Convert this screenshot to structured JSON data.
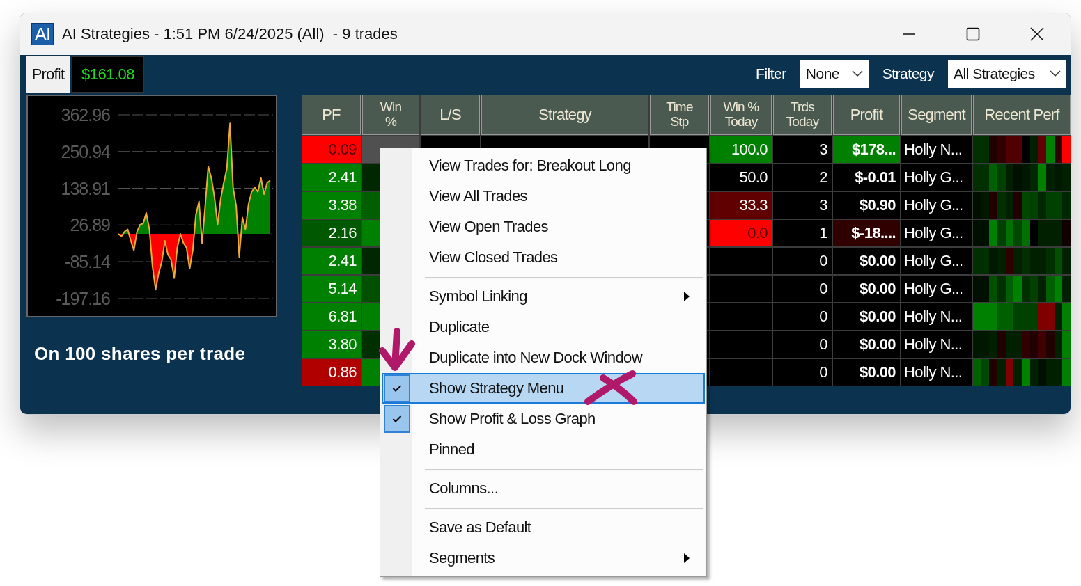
{
  "window": {
    "logo": "AI",
    "title": "AI Strategies - 1:51 PM 6/24/2025 (All)  - 9 trades"
  },
  "summary": {
    "label": "Profit",
    "value": "$161.08",
    "caption": "On 100 shares per trade"
  },
  "chart_data": {
    "type": "line",
    "grid": true,
    "ylim": [
      -197.16,
      362.96
    ],
    "yticks": [
      {
        "value": 362.96,
        "label": "362.96"
      },
      {
        "value": 250.94,
        "label": "250.94"
      },
      {
        "value": 138.91,
        "label": "138.91"
      },
      {
        "value": 26.89,
        "label": "26.89"
      },
      {
        "value": -85.14,
        "label": "-85.14"
      },
      {
        "value": -197.16,
        "label": "-197.16"
      }
    ],
    "series": [
      {
        "color": "#f0a838",
        "values": [
          0,
          -7,
          7,
          14,
          -21,
          -50,
          7,
          28,
          32,
          64,
          14,
          -99,
          -170,
          -120,
          -85,
          -21,
          -64,
          -78,
          -135,
          -43,
          0,
          -28,
          -43,
          -106,
          -50,
          57,
          99,
          -28,
          85,
          206,
          170,
          113,
          28,
          106,
          156,
          199,
          337,
          142,
          85,
          -71,
          50,
          14,
          92,
          128,
          142,
          128,
          170,
          121,
          156,
          163
        ]
      }
    ]
  },
  "filter": {
    "label": "Filter",
    "value": "None"
  },
  "strategy_filter": {
    "label": "Strategy",
    "value": "All Strategies"
  },
  "table": {
    "columns": [
      "PF",
      "Win\n%",
      "L/S",
      "Strategy",
      "Time\nStp",
      "Win %\nToday",
      "Trds\nToday",
      "Profit",
      "Segment",
      "Recent Perf"
    ],
    "rows": [
      {
        "pf": {
          "text": "0.09",
          "color": "#ff0000"
        },
        "win": {
          "color": "#505050"
        },
        "today_win": {
          "text": "100.0",
          "color": "#008000"
        },
        "trades": "3",
        "profit": {
          "text": "$178...",
          "color": "#008000"
        },
        "segment": "Holly N...",
        "perf": [
          {
            "color": "#003000"
          },
          {
            "color": "#003000"
          },
          {
            "color": "#200000"
          },
          {
            "color": "#300000"
          },
          {
            "color": "#500000"
          },
          {
            "color": "#500000"
          },
          {
            "color": "#000000"
          },
          {
            "color": "#002000"
          },
          {
            "color": "#600000"
          },
          {
            "color": "#008000"
          },
          {
            "color": "#300000"
          },
          {
            "color": "#ff0000"
          }
        ]
      },
      {
        "pf": {
          "text": "2.41",
          "color": "#008000"
        },
        "win": {
          "color": "#002800"
        },
        "today_win": {
          "text": "50.0",
          "color": "#000000"
        },
        "trades": "2",
        "profit": {
          "text": "$-0.01",
          "color": "#000000"
        },
        "segment": "Holly G...",
        "perf": [
          {
            "color": "#003000"
          },
          {
            "color": "#003000"
          },
          {
            "color": "#006000"
          },
          {
            "color": "#004000"
          },
          {
            "color": "#002000"
          },
          {
            "color": "#001000"
          },
          {
            "color": "#001800"
          },
          {
            "color": "#002800"
          },
          {
            "color": "#008000"
          },
          {
            "color": "#002000"
          },
          {
            "color": "#001800"
          },
          {
            "color": "#002000"
          }
        ]
      },
      {
        "pf": {
          "text": "3.38",
          "color": "#008000"
        },
        "win": {
          "color": "#006000"
        },
        "today_win": {
          "text": "33.3",
          "color": "#600000"
        },
        "trades": "3",
        "profit": {
          "text": "$0.90",
          "color": "#000000"
        },
        "segment": "Holly G...",
        "perf": [
          {
            "color": "#001000"
          },
          {
            "color": "#001800"
          },
          {
            "color": "#200000"
          },
          {
            "color": "#003000"
          },
          {
            "color": "#002000"
          },
          {
            "color": "#200000"
          },
          {
            "color": "#004800"
          },
          {
            "color": "#004000"
          },
          {
            "color": "#002800"
          },
          {
            "color": "#004000"
          },
          {
            "color": "#004000"
          },
          {
            "color": "#002800"
          }
        ]
      },
      {
        "pf": {
          "text": "2.16",
          "color": "#005800"
        },
        "win": {
          "color": "#008000"
        },
        "today_win": {
          "text": "0.0",
          "color": "#ff0000"
        },
        "trades": "1",
        "profit": {
          "text": "$-18....",
          "color": "#300000"
        },
        "segment": "Holly G...",
        "perf": [
          {
            "color": "#001000"
          },
          {
            "color": "#001000"
          },
          {
            "color": "#008000"
          },
          {
            "color": "#004000"
          },
          {
            "color": "#007000"
          },
          {
            "color": "#004800"
          },
          {
            "color": "#007000"
          },
          {
            "color": "#000000"
          },
          {
            "color": "#002000"
          },
          {
            "color": "#002000"
          },
          {
            "color": "#002000"
          },
          {
            "color": "#100000"
          }
        ]
      },
      {
        "pf": {
          "text": "2.41",
          "color": "#008000"
        },
        "win": {
          "color": "#002800"
        },
        "today_win": {
          "color": "#000000"
        },
        "trades": "0",
        "profit": {
          "text": "$0.00",
          "color": "#000000"
        },
        "segment": "Holly G...",
        "perf": [
          {
            "color": "#003000"
          },
          {
            "color": "#003000"
          },
          {
            "color": "#001800"
          },
          {
            "color": "#002000"
          },
          {
            "color": "#300000"
          },
          {
            "color": "#002000"
          },
          {
            "color": "#003000"
          },
          {
            "color": "#002000"
          },
          {
            "color": "#002000"
          },
          {
            "color": "#003000"
          },
          {
            "color": "#005000"
          },
          {
            "color": "#002000"
          }
        ]
      },
      {
        "pf": {
          "text": "5.14",
          "color": "#008000"
        },
        "win": {
          "color": "#005000"
        },
        "today_win": {
          "color": "#000000"
        },
        "trades": "0",
        "profit": {
          "text": "$0.00",
          "color": "#000000"
        },
        "segment": "Holly G...",
        "perf": [
          {
            "color": "#001000"
          },
          {
            "color": "#001000"
          },
          {
            "color": "#005000"
          },
          {
            "color": "#003000"
          },
          {
            "color": "#006000"
          },
          {
            "color": "#008000"
          },
          {
            "color": "#003000"
          },
          {
            "color": "#004000"
          },
          {
            "color": "#002000"
          },
          {
            "color": "#006000"
          },
          {
            "color": "#008000"
          },
          {
            "color": "#002000"
          }
        ]
      },
      {
        "pf": {
          "text": "6.81",
          "color": "#008000"
        },
        "win": {
          "color": "#008000"
        },
        "today_win": {
          "color": "#000000"
        },
        "trades": "0",
        "profit": {
          "text": "$0.00",
          "color": "#000000"
        },
        "segment": "Holly N...",
        "perf": [
          {
            "color": "#008000"
          },
          {
            "color": "#008000"
          },
          {
            "color": "#008000"
          },
          {
            "color": "#006000"
          },
          {
            "color": "#006000"
          },
          {
            "color": "#004000"
          },
          {
            "color": "#004000"
          },
          {
            "color": "#004000"
          },
          {
            "color": "#800000"
          },
          {
            "color": "#800000"
          },
          {
            "color": "#002000"
          },
          {
            "color": "#008000"
          }
        ]
      },
      {
        "pf": {
          "text": "3.80",
          "color": "#008000"
        },
        "win": {
          "color": "#003000"
        },
        "today_win": {
          "color": "#000000"
        },
        "trades": "0",
        "profit": {
          "text": "$0.00",
          "color": "#000000"
        },
        "segment": "Holly N...",
        "perf": [
          {
            "color": "#001800"
          },
          {
            "color": "#001800"
          },
          {
            "color": "#002000"
          },
          {
            "color": "#200000"
          },
          {
            "color": "#002000"
          },
          {
            "color": "#002000"
          },
          {
            "color": "#300000"
          },
          {
            "color": "#200000"
          },
          {
            "color": "#400000"
          },
          {
            "color": "#200000"
          },
          {
            "color": "#002000"
          },
          {
            "color": "#008000"
          }
        ]
      },
      {
        "pf": {
          "text": "0.86",
          "color": "#b00000"
        },
        "win": {
          "color": "#008000"
        },
        "today_win": {
          "color": "#000000"
        },
        "trades": "0",
        "profit": {
          "text": "$0.00",
          "color": "#000000"
        },
        "segment": "Holly N...",
        "perf": [
          {
            "color": "#006000"
          },
          {
            "color": "#004800"
          },
          {
            "color": "#200000"
          },
          {
            "color": "#002000"
          },
          {
            "color": "#800000"
          },
          {
            "color": "#002000"
          },
          {
            "color": "#008000"
          },
          {
            "color": "#002000"
          },
          {
            "color": "#001000"
          },
          {
            "color": "#002000"
          },
          {
            "color": "#002000"
          },
          {
            "color": "#008000"
          }
        ]
      }
    ]
  },
  "context_menu": {
    "items": [
      {
        "kind": "item",
        "label": "View Trades for: Breakout Long",
        "checked": false,
        "selected": false,
        "submenu": false
      },
      {
        "kind": "item",
        "label": "View All Trades",
        "checked": false,
        "selected": false,
        "submenu": false
      },
      {
        "kind": "item",
        "label": "View Open Trades",
        "checked": false,
        "selected": false,
        "submenu": false
      },
      {
        "kind": "item",
        "label": "View Closed Trades",
        "checked": false,
        "selected": false,
        "submenu": false
      },
      {
        "kind": "separator"
      },
      {
        "kind": "item",
        "label": "Symbol Linking",
        "checked": false,
        "selected": false,
        "submenu": true
      },
      {
        "kind": "item",
        "label": "Duplicate",
        "checked": false,
        "selected": false,
        "submenu": false
      },
      {
        "kind": "item",
        "label": "Duplicate into New Dock Window",
        "checked": false,
        "selected": false,
        "submenu": false
      },
      {
        "kind": "item",
        "label": "Show Strategy Menu",
        "checked": true,
        "selected": true,
        "submenu": false
      },
      {
        "kind": "item",
        "label": "Show Profit & Loss Graph",
        "checked": true,
        "selected": false,
        "submenu": false
      },
      {
        "kind": "item",
        "label": "Pinned",
        "checked": false,
        "selected": false,
        "submenu": false
      },
      {
        "kind": "separator"
      },
      {
        "kind": "item",
        "label": "Columns...",
        "checked": false,
        "selected": false,
        "submenu": false
      },
      {
        "kind": "separator"
      },
      {
        "kind": "item",
        "label": "Save as Default",
        "checked": false,
        "selected": false,
        "submenu": false
      },
      {
        "kind": "item",
        "label": "Segments",
        "checked": false,
        "selected": false,
        "submenu": true
      }
    ]
  }
}
